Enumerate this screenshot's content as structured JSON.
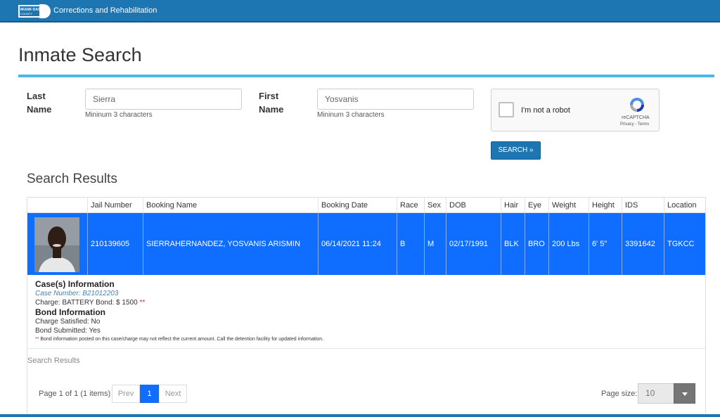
{
  "header": {
    "logo_line1": "MIAMI·DADE",
    "logo_line2": "COUNTY",
    "title": "Corrections and Rehabilitation"
  },
  "page": {
    "title": "Inmate Search"
  },
  "form": {
    "last_name_label": "Last Name",
    "last_name_value": "Sierra",
    "last_name_hint": "Mininum 3 characters",
    "first_name_label": "First Name",
    "first_name_value": "Yosvanis",
    "first_name_hint": "Mininum 3 characters",
    "captcha_text": "I'm not a robot",
    "captcha_brand": "reCAPTCHA",
    "captcha_links": "Privacy - Terms",
    "search_label": "SEARCH »"
  },
  "results": {
    "heading": "Search Results",
    "columns": [
      "",
      "Jail Number",
      "Booking Name",
      "Booking Date",
      "Race",
      "Sex",
      "DOB",
      "Hair",
      "Eye",
      "Weight",
      "Height",
      "IDS",
      "Location"
    ],
    "row": {
      "jail_number": "210139605",
      "booking_name": "SIERRAHERNANDEZ, YOSVANIS ARISMIN",
      "booking_date": "06/14/2021 11:24",
      "race": "B",
      "sex": "M",
      "dob": "02/17/1991",
      "hair": "BLK",
      "eye": "BRO",
      "weight": "200 Lbs",
      "height": "6' 5\"",
      "ids": "3391642",
      "location": "TGKCC"
    },
    "details": {
      "cases_heading": "Case(s) Information",
      "case_number": "Case Number: B21012203",
      "charge_line": "Charge: BATTERY Bond: $ 1500",
      "marker": "**",
      "bond_heading": "Bond Information",
      "charge_satisfied": "Charge Satisfied: No",
      "bond_submitted": "Bond Submitted: Yes",
      "note": "Bond information posted on this case/charge may not reflect the current amount. Call the detention facility for updated information."
    },
    "footer_label": "Search Results",
    "pager": {
      "info": "Page 1 of 1 (1 items)",
      "prev": "Prev",
      "current": "1",
      "next": "Next",
      "page_size_label": "Page size:",
      "page_size_value": "10"
    }
  },
  "colors": {
    "header_blue": "#1d76b1",
    "accent_rule": "#4ab9e8",
    "selected_row": "#0f6eff"
  }
}
